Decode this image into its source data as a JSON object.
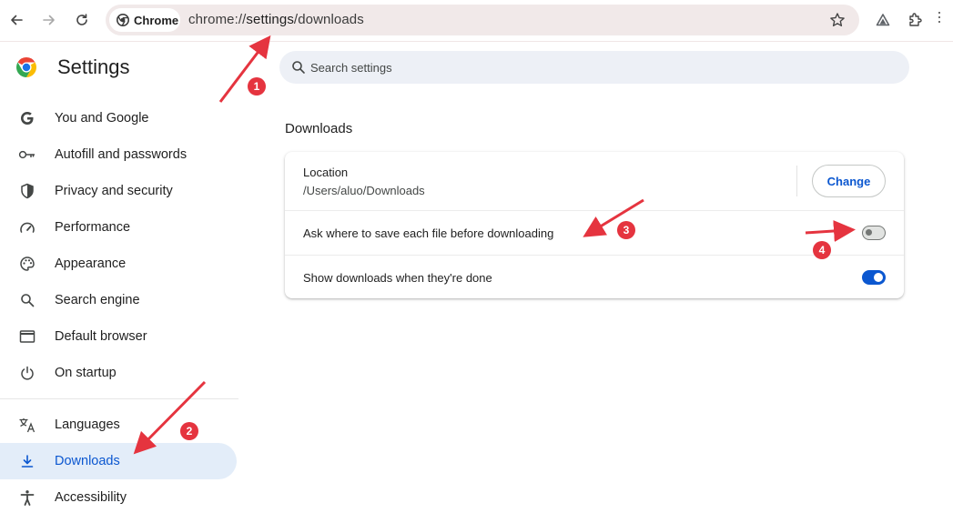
{
  "toolbar": {
    "chip_label": "Chrome",
    "url_prefix": "chrome://",
    "url_host": "settings",
    "url_path": "/downloads"
  },
  "app": {
    "title": "Settings"
  },
  "search": {
    "placeholder": "Search settings"
  },
  "sidebar": {
    "items": [
      {
        "label": "You and Google",
        "icon": "google-icon"
      },
      {
        "label": "Autofill and passwords",
        "icon": "key-icon"
      },
      {
        "label": "Privacy and security",
        "icon": "shield-icon"
      },
      {
        "label": "Performance",
        "icon": "speedometer-icon"
      },
      {
        "label": "Appearance",
        "icon": "palette-icon"
      },
      {
        "label": "Search engine",
        "icon": "search-icon"
      },
      {
        "label": "Default browser",
        "icon": "browser-window-icon"
      },
      {
        "label": "On startup",
        "icon": "power-icon"
      },
      {
        "label": "Languages",
        "icon": "translate-icon"
      },
      {
        "label": "Downloads",
        "icon": "download-icon",
        "active": true
      },
      {
        "label": "Accessibility",
        "icon": "accessibility-icon"
      }
    ]
  },
  "downloads": {
    "section_title": "Downloads",
    "location_label": "Location",
    "location_value": "/Users/aluo/Downloads",
    "change_label": "Change",
    "ask_label": "Ask where to save each file before downloading",
    "ask_enabled": false,
    "show_label": "Show downloads when they're done",
    "show_enabled": true
  },
  "annotations": {
    "badges": [
      "1",
      "2",
      "3",
      "4"
    ],
    "color": "#e5343f"
  },
  "colors": {
    "accent": "#0b57d0",
    "active_bg": "#e3edf9",
    "omnibox_bg": "#f1e9e9",
    "search_bg": "#edf0f6"
  }
}
